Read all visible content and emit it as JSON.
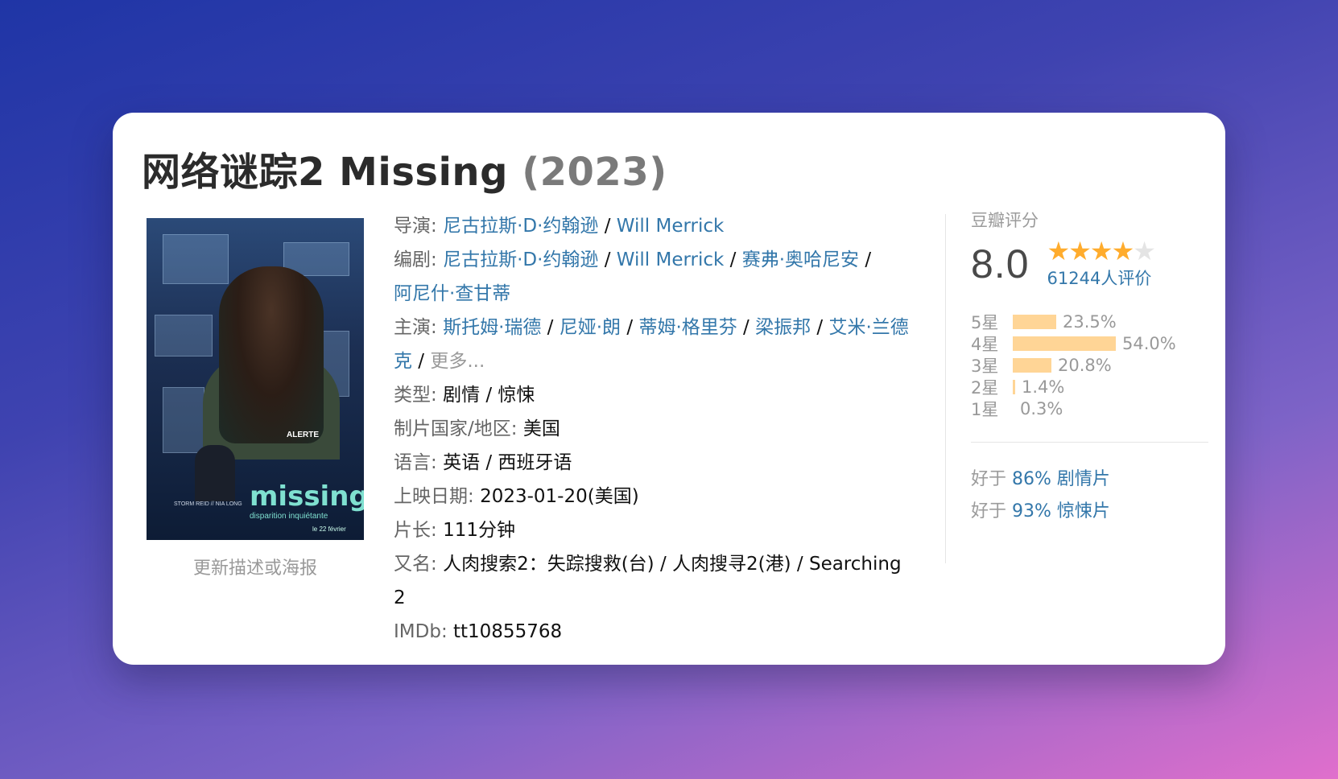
{
  "movie": {
    "title": "网络谜踪2 Missing",
    "year": "(2023)",
    "update_link": "更新描述或海报"
  },
  "poster": {
    "logo_text": "missing",
    "subtitle": "disparition inquiétante",
    "alert_text": "ALERTE",
    "credits": "STORM REID // NIA LONG",
    "date": "le 22 février"
  },
  "info": {
    "director_label": "导演",
    "directors": [
      "尼古拉斯·D·约翰逊",
      "Will Merrick"
    ],
    "writer_label": "编剧",
    "writers": [
      "尼古拉斯·D·约翰逊",
      "Will Merrick",
      "赛弗·奥哈尼安",
      "阿尼什·查甘蒂"
    ],
    "cast_label": "主演",
    "cast": [
      "斯托姆·瑞德",
      "尼娅·朗",
      "蒂姆·格里芬",
      "梁振邦",
      "艾米·兰德克"
    ],
    "more": "更多...",
    "genre_label": "类型",
    "genres": "剧情 / 惊悚",
    "country_label": "制片国家/地区",
    "country": "美国",
    "language_label": "语言",
    "language": "英语 / 西班牙语",
    "release_label": "上映日期",
    "release": "2023-01-20(美国)",
    "runtime_label": "片长",
    "runtime": "111分钟",
    "aka_label": "又名",
    "aka": "人肉搜索2：失踪搜救(台) / 人肉搜寻2(港) / Searching 2",
    "imdb_label": "IMDb",
    "imdb": "tt10855768"
  },
  "rating": {
    "heading": "豆瓣评分",
    "score": "8.0",
    "stars_filled": 4,
    "stars_total": 5,
    "count": "61244人评价",
    "distribution": [
      {
        "label": "5星",
        "percent": 23.5,
        "text": "23.5%"
      },
      {
        "label": "4星",
        "percent": 54.0,
        "text": "54.0%"
      },
      {
        "label": "3星",
        "percent": 20.8,
        "text": "20.8%"
      },
      {
        "label": "2星",
        "percent": 1.4,
        "text": "1.4%"
      },
      {
        "label": "1星",
        "percent": 0.3,
        "text": "0.3%"
      }
    ],
    "better_than": [
      {
        "prefix": "好于",
        "value": "86% 剧情片"
      },
      {
        "prefix": "好于",
        "value": "93% 惊悚片"
      }
    ]
  }
}
